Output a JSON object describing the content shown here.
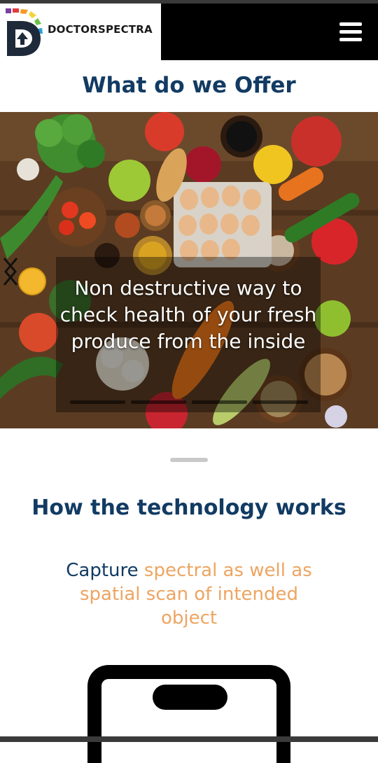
{
  "header": {
    "brand": "DOCTORSPECTRA",
    "menu_icon": "hamburger-menu-icon"
  },
  "offer": {
    "title": "What do we Offer"
  },
  "carousel": {
    "slide_caption": "Non destructive way to check health of your fresh produce from the inside",
    "prev_icon": "chevron-left-icon",
    "next_icon": "chevron-right-icon",
    "indicator_count": 4
  },
  "technology": {
    "title": "How the technology works",
    "desc_dark": "Capture",
    "desc_highlight": "spectral as well as spatial scan of intended object"
  },
  "colors": {
    "navy": "#123b63",
    "orange": "#eda562",
    "navbar": "#000000"
  }
}
